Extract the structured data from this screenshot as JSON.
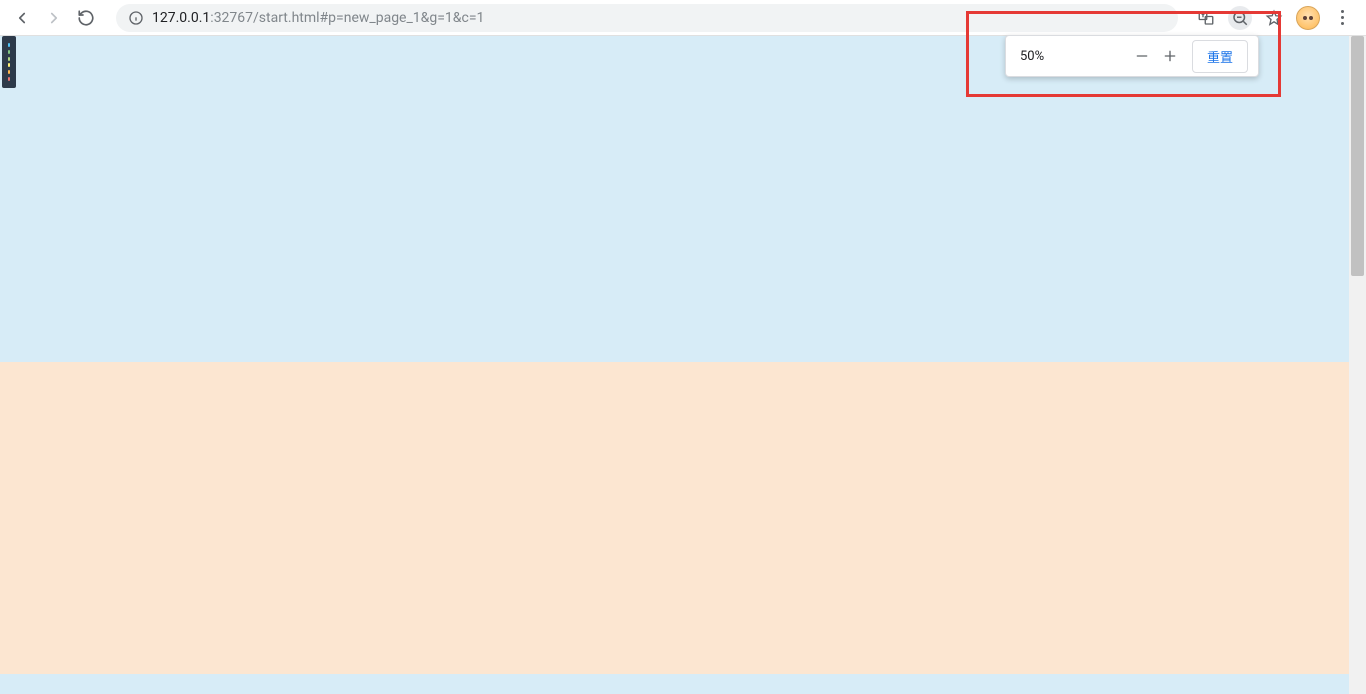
{
  "toolbar": {
    "url_host": "127.0.0.1",
    "url_port_path": ":32767/start.html#p=new_page_1&g=1&c=1"
  },
  "zoom": {
    "level": "50%",
    "reset_label": "重置"
  }
}
